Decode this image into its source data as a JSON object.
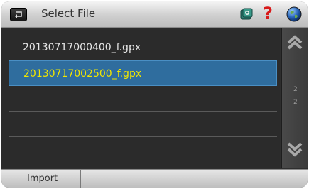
{
  "header": {
    "title": "Select File",
    "icons": [
      "back-icon",
      "photo-icon",
      "help-icon",
      "globe-icon"
    ],
    "help_glyph": "?"
  },
  "files": [
    {
      "name": "20130717000400_f.gpx",
      "selected": false
    },
    {
      "name": "20130717002500_f.gpx",
      "selected": true
    },
    {
      "name": "",
      "selected": false
    },
    {
      "name": "",
      "selected": false
    },
    {
      "name": "",
      "selected": false
    }
  ],
  "scroll": {
    "current_page": "2",
    "total_pages": "2"
  },
  "bottom": {
    "import_label": "Import"
  },
  "colors": {
    "selection": "#2f6d9e",
    "selected_text": "#f2e600"
  }
}
